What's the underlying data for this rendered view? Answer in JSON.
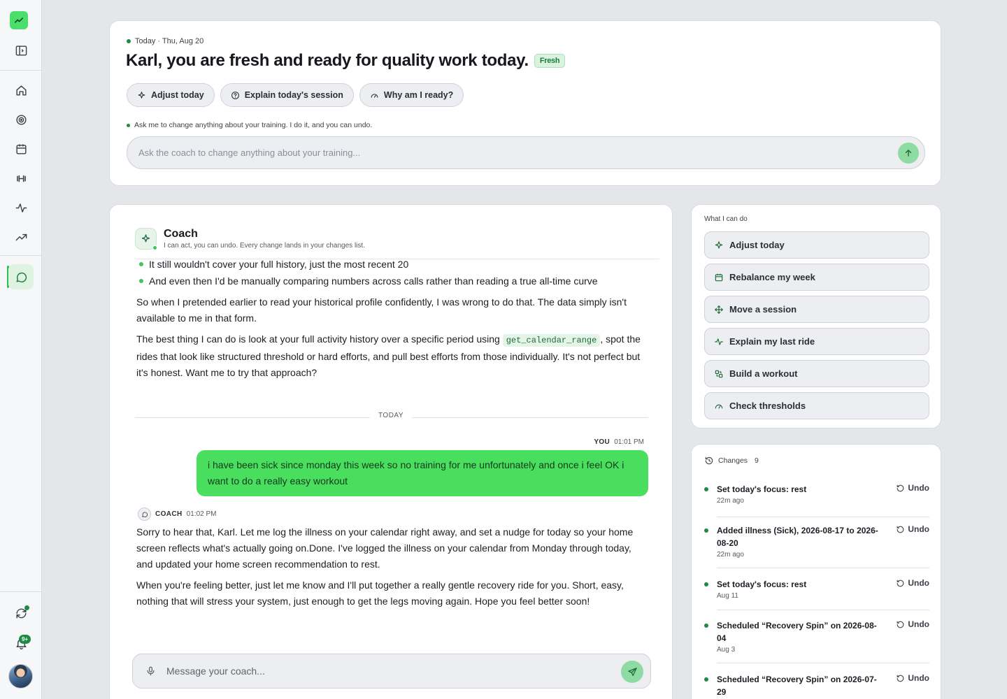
{
  "colors": {
    "accent": "#4ade5e",
    "brand": "#1f8a45",
    "badge_bg": "#d8f4de"
  },
  "sidebar": {
    "logo_icon": "trend-chart-icon",
    "icons": [
      "panel-toggle-icon",
      "home-icon",
      "target-icon",
      "calendar-icon",
      "dumbbell-icon",
      "activity-icon",
      "trending-up-icon",
      "chat-icon"
    ],
    "bottom_icons": [
      "sync-icon",
      "bell-icon",
      "avatar"
    ],
    "notification_badge": "9+"
  },
  "header": {
    "date": "Today · Thu, Aug 20",
    "headline": "Karl, you are fresh and ready for quality work today.",
    "status_badge": "Fresh",
    "chips": [
      {
        "label": "Adjust today",
        "icon": "sparkle-icon"
      },
      {
        "label": "Explain today's session",
        "icon": "help-circle-icon"
      },
      {
        "label": "Why am I ready?",
        "icon": "gauge-icon"
      }
    ],
    "hint": "Ask me to change anything about your training. I do it, and you can undo.",
    "ask_placeholder": "Ask the coach to change anything about your training..."
  },
  "chat": {
    "title": "Coach",
    "subtitle": "I can act, you can undo. Every change lands in your changes list.",
    "bullets": [
      "It still wouldn't cover your full history, just the most recent 20",
      "And even then I'd be manually comparing numbers across calls rather than reading a true all-time curve"
    ],
    "para1": "So when I pretended earlier to read your historical profile confidently, I was wrong to do that. The data simply isn't available to me in that form.",
    "para2_pre": "The best thing I can do is look at your full activity history over a specific period using ",
    "para2_code": "get_calendar_range",
    "para2_post": ", spot the rides that look like structured threshold or hard efforts, and pull best efforts from those individually. It's not perfect but it's honest. Want me to try that approach?",
    "day_separator": "TODAY",
    "user_label": "YOU",
    "user_time": "01:01 PM",
    "user_message": "i have been sick since monday this week so no training for me unfortunately and once i feel OK i want to do a really easy workout",
    "coach_label": "COACH",
    "coach_time": "01:02 PM",
    "reply1": "Sorry to hear that, Karl. Let me log the illness on your calendar right away, and set a nudge for today so your home screen reflects what's actually going on.Done. I've logged the illness on your calendar from Monday through today, and updated your home screen recommendation to rest.",
    "reply2": "When you're feeling better, just let me know and I'll put together a really gentle recovery ride for you. Short, easy, nothing that will stress your system, just enough to get the legs moving again. Hope you feel better soon!",
    "composer_placeholder": "Message your coach..."
  },
  "capabilities": {
    "label": "What I can do",
    "items": [
      {
        "label": "Adjust today",
        "icon": "sparkle-icon"
      },
      {
        "label": "Rebalance my week",
        "icon": "calendar-icon"
      },
      {
        "label": "Move a session",
        "icon": "move-icon"
      },
      {
        "label": "Explain my last ride",
        "icon": "activity-icon"
      },
      {
        "label": "Build a workout",
        "icon": "workout-icon"
      },
      {
        "label": "Check thresholds",
        "icon": "gauge-icon"
      }
    ]
  },
  "changes": {
    "label": "Changes",
    "count": "9",
    "undo_label": "Undo",
    "items": [
      {
        "title": "Set today's focus: rest",
        "when": "22m ago"
      },
      {
        "title": "Added illness (Sick), 2026-08-17 to 2026-08-20",
        "when": "22m ago"
      },
      {
        "title": "Set today's focus: rest",
        "when": "Aug 11"
      },
      {
        "title": "Scheduled “Recovery Spin” on 2026-08-04",
        "when": "Aug 3"
      },
      {
        "title": "Scheduled “Recovery Spin” on 2026-07-29",
        "when": ""
      }
    ]
  }
}
